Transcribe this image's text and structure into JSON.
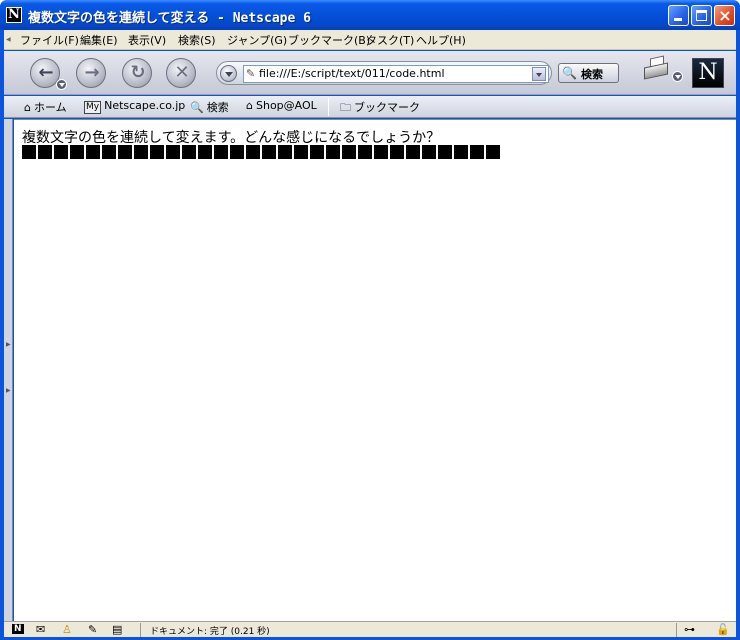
{
  "window": {
    "title": "複数文字の色を連続して変える - Netscape 6",
    "app_icon_letter": "N",
    "close_glyph": "×"
  },
  "menubar": {
    "items": [
      {
        "label": "ファイル(F)"
      },
      {
        "label": "編集(E)"
      },
      {
        "label": "表示(V)"
      },
      {
        "label": "検索(S)"
      },
      {
        "label": "ジャンプ(G)"
      },
      {
        "label": "ブックマーク(B)"
      },
      {
        "label": "タスク(T)"
      },
      {
        "label": "ヘルプ(H)"
      }
    ]
  },
  "navbar": {
    "back_glyph": "←",
    "forward_glyph": "→",
    "reload_glyph": "↻",
    "stop_glyph": "✕",
    "url": "file:///E:/script/text/011/code.html",
    "search_label": "検索",
    "logo_letter": "N"
  },
  "personal_toolbar": {
    "home": "ホーム",
    "my_badge": "My",
    "netscape": "Netscape.co.jp",
    "search": "検索",
    "shop": "Shop@AOL",
    "bookmarks": "ブックマーク"
  },
  "content": {
    "text": "複数文字の色を連続して変えます。どんな感じになるでしょうか？",
    "block_count": 30,
    "block_color": "#000000"
  },
  "statusbar": {
    "text": "ドキュメント: 完了 (0.21 秒)"
  },
  "colors": {
    "titlebar": "#0450d8",
    "chrome": "#ece9d8"
  },
  "icons": {
    "app": "netscape-n-icon",
    "home": "home-icon",
    "search": "magnifier-icon",
    "shop": "shop-icon",
    "bookmarks": "folder-icon",
    "print": "printer-icon",
    "mail": "mail-icon",
    "instant_messenger": "aim-icon",
    "composer": "composer-icon",
    "address_book": "address-book-icon",
    "lock": "lock-icon"
  }
}
